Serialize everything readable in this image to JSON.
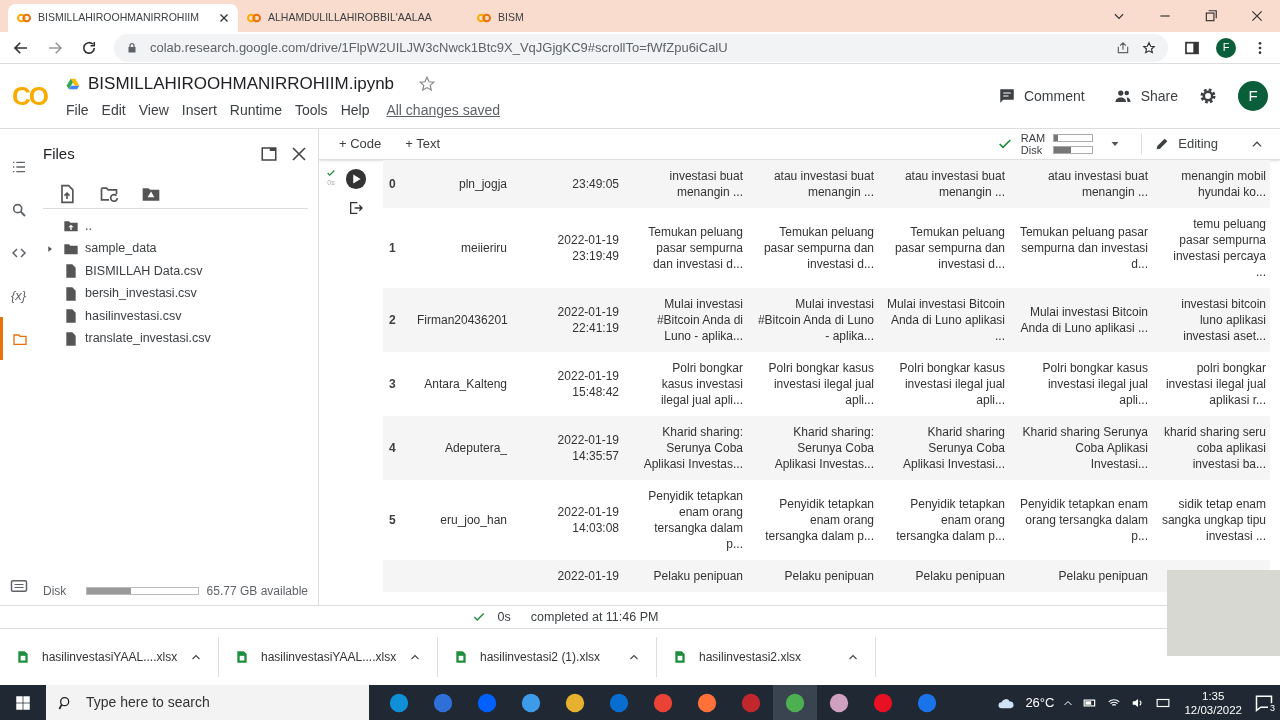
{
  "browser": {
    "tabs": [
      {
        "label": "BISMILLAHIROOHMANIRROHIIM",
        "selected": true
      },
      {
        "label": "ALHAMDULILLAHIROBBIL'AALAA",
        "selected": false
      },
      {
        "label": "BISM",
        "selected": false
      }
    ],
    "url": "colab.research.google.com/drive/1FlpW2UILJW3cNwck1Btc9X_VqJGjgKC9#scrollTo=fWfZpu6iCalU",
    "profile": "F"
  },
  "notebook": {
    "logo": "CO",
    "title": "BISMILLAHIROOHMANIRROHIIM.ipynb",
    "menu": [
      "File",
      "Edit",
      "View",
      "Insert",
      "Runtime",
      "Tools",
      "Help"
    ],
    "save_status": "All changes saved",
    "comment": "Comment",
    "share": "Share",
    "avatar": "F"
  },
  "toolbar": {
    "add_code": "+ Code",
    "add_text": "+ Text",
    "ram_label": "RAM",
    "disk_label": "Disk",
    "ram": {
      "level": 0.1
    },
    "disk": {
      "level": 0.45
    },
    "mode": "Editing"
  },
  "rail": [
    {
      "selected": false
    },
    {
      "selected": false
    },
    {
      "selected": false
    },
    {
      "glyph": "{x}",
      "selected": false
    },
    {
      "selected": true
    }
  ],
  "files_panel": {
    "title": "Files",
    "items": [
      {
        "kind": "parent",
        "name": ".."
      },
      {
        "kind": "folder",
        "name": "sample_data",
        "expanded": false
      },
      {
        "kind": "file",
        "name": "BISMILLAH Data.csv"
      },
      {
        "kind": "file",
        "name": "bersih_investasi.csv"
      },
      {
        "kind": "file",
        "name": "hasilinvestasi.csv"
      },
      {
        "kind": "file",
        "name": "translate_investasi.csv"
      }
    ],
    "disk_label": "Disk",
    "disk": {
      "level": 0.4
    },
    "disk_free": "65.77 GB available"
  },
  "cell": {
    "exec_time": "0s"
  },
  "table": {
    "rows": [
      {
        "index": "0",
        "user": "pln_jogja",
        "date": "23:49:05",
        "texts": [
          "investasi buat menangin ...",
          "atau investasi buat menangin ...",
          "atau investasi buat menangin ...",
          "atau investasi buat menangin ...",
          "menangin mobil hyundai ko..."
        ]
      },
      {
        "index": "1",
        "user": "meiieriru",
        "date": "2022-01-19 23:19:49",
        "texts": [
          "Temukan peluang pasar sempurna dan investasi d...",
          "Temukan peluang pasar sempurna dan investasi d...",
          "Temukan peluang pasar sempurna dan investasi d...",
          "Temukan peluang pasar sempurna dan investasi d...",
          "temu peluang pasar sempurna investasi percaya ..."
        ]
      },
      {
        "index": "2",
        "user": "Firman20436201",
        "date": "2022-01-19 22:41:19",
        "texts": [
          "Mulai investasi #Bitcoin Anda di Luno - aplika...",
          "Mulai investasi #Bitcoin Anda di Luno - aplika...",
          "Mulai investasi Bitcoin Anda di Luno aplikasi ...",
          "Mulai investasi Bitcoin Anda di Luno aplikasi ...",
          "investasi bitcoin luno aplikasi investasi aset..."
        ]
      },
      {
        "index": "3",
        "user": "Antara_Kalteng",
        "date": "2022-01-19 15:48:42",
        "texts": [
          "Polri bongkar kasus investasi ilegal jual apli...",
          "Polri bongkar kasus investasi ilegal jual apli...",
          "Polri bongkar kasus investasi ilegal jual apli...",
          "Polri bongkar kasus investasi ilegal jual apli...",
          "polri bongkar investasi ilegal jual aplikasi r..."
        ]
      },
      {
        "index": "4",
        "user": "Adeputera_",
        "date": "2022-01-19 14:35:57",
        "texts": [
          "Kharid sharing: Serunya Coba Aplikasi Investas...",
          "Kharid sharing: Serunya Coba Aplikasi Investas...",
          "Kharid sharing Serunya Coba Aplikasi Investasi...",
          "Kharid sharing Serunya Coba Aplikasi Investasi...",
          "kharid sharing seru coba aplikasi investasi ba..."
        ]
      },
      {
        "index": "5",
        "user": "eru_joo_han",
        "date": "2022-01-19 14:03:08",
        "texts": [
          "Penyidik tetapkan enam orang tersangka dalam p...",
          "Penyidik tetapkan enam orang tersangka dalam p...",
          "Penyidik tetapkan enam orang tersangka dalam p...",
          "Penyidik tetapkan enam orang tersangka dalam p...",
          "sidik tetap enam sangka ungkap tipu investasi ..."
        ]
      },
      {
        "date": "2022-01-19",
        "texts": [
          "Pelaku penipuan",
          "Pelaku penipuan",
          "Pelaku penipuan",
          "Pelaku penipuan"
        ]
      }
    ]
  },
  "status_bar": {
    "time": "0s",
    "message": "completed at 11:46 PM"
  },
  "downloads": [
    "hasilinvestasiYAAL....xlsx",
    "hasilinvestasiYAAL....xlsx",
    "hasilinvestasi2 (1).xlsx",
    "hasilinvestasi2.xlsx"
  ],
  "taskbar": {
    "search_placeholder": "Type here to search",
    "temperature": "26°C",
    "time": "1:35",
    "date": "12/03/2022",
    "notifications": "3"
  }
}
